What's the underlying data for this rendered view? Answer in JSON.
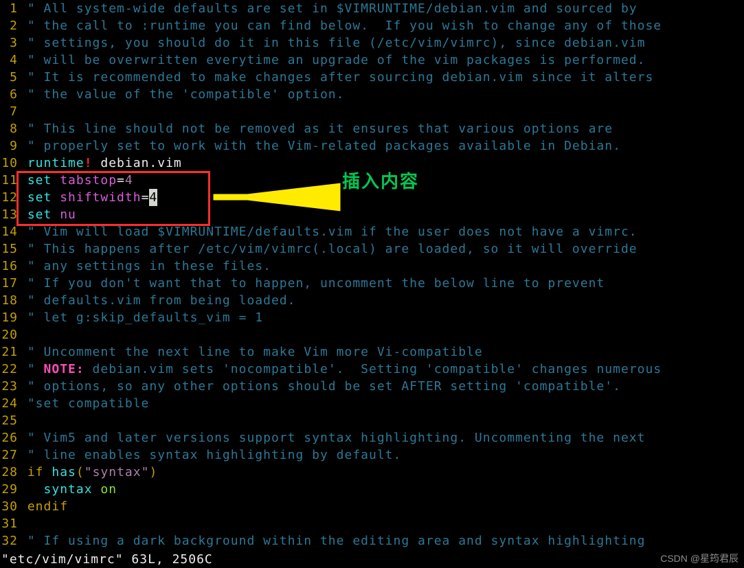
{
  "file_path": "/etc/vim/vimrc",
  "annotation_label": "插入内容",
  "watermark": "CSDN @星筠君辰",
  "status_line": "\"etc/vim/vimrc\" 63L, 2506C",
  "line_numbers": [
    "1",
    "2",
    "3",
    "4",
    "5",
    "6",
    "7",
    "8",
    "9",
    "10",
    "11",
    "12",
    "13",
    "14",
    "15",
    "16",
    "17",
    "18",
    "19",
    "20",
    "21",
    "22",
    "23",
    "24",
    "25",
    "26",
    "27",
    "28",
    "29",
    "30",
    "31",
    "32"
  ],
  "lines": {
    "l01": "\" All system-wide defaults are set in $VIMRUNTIME/debian.vim and sourced by",
    "l02": "\" the call to :runtime you can find below.  If you wish to change any of those",
    "l03": "\" settings, you should do it in this file (/etc/vim/vimrc), since debian.vim",
    "l04": "\" will be overwritten everytime an upgrade of the vim packages is performed.",
    "l05": "\" It is recommended to make changes after sourcing debian.vim since it alters",
    "l06": "\" the value of the 'compatible' option.",
    "l07": "",
    "l08": "\" This line should not be removed as it ensures that various options are",
    "l09": "\" properly set to work with the Vim-related packages available in Debian.",
    "l10_runtime_kw": "runtime",
    "l10_bang": "!",
    "l10_rest": " debian.vim",
    "l11_set": "set",
    "l11_opt": " tabstop",
    "l11_eq": "=",
    "l11_val": "4",
    "l12_set": "set",
    "l12_opt": " shiftwidth",
    "l12_eq": "=",
    "l12_val": "4",
    "l13_set": "set",
    "l13_opt": " nu",
    "l14": "\" Vim will load $VIMRUNTIME/defaults.vim if the user does not have a vimrc.",
    "l15": "\" This happens after /etc/vim/vimrc(.local) are loaded, so it will override",
    "l16": "\" any settings in these files.",
    "l17": "\" If you don't want that to happen, uncomment the below line to prevent",
    "l18": "\" defaults.vim from being loaded.",
    "l19": "\" let g:skip_defaults_vim = 1",
    "l20": "",
    "l21": "\" Uncomment the next line to make Vim more Vi-compatible",
    "l22_pre": "\" ",
    "l22_note": "NOTE:",
    "l22_rest": " debian.vim sets 'nocompatible'.  Setting 'compatible' changes numerous",
    "l23": "\" options, so any other options should be set AFTER setting 'compatible'.",
    "l24": "\"set compatible",
    "l25": "",
    "l26": "\" Vim5 and later versions support syntax highlighting. Uncommenting the next",
    "l27": "\" line enables syntax highlighting by default.",
    "l28_if": "if",
    "l28_sp": " ",
    "l28_has": "has",
    "l28_p1": "(",
    "l28_str": "\"syntax\"",
    "l28_p2": ")",
    "l29_pad": "  ",
    "l29_syn": "syntax",
    "l29_sp": " ",
    "l29_on": "on",
    "l30": "endif",
    "l31": "",
    "l32": "\" If using a dark background within the editing area and syntax highlighting"
  }
}
